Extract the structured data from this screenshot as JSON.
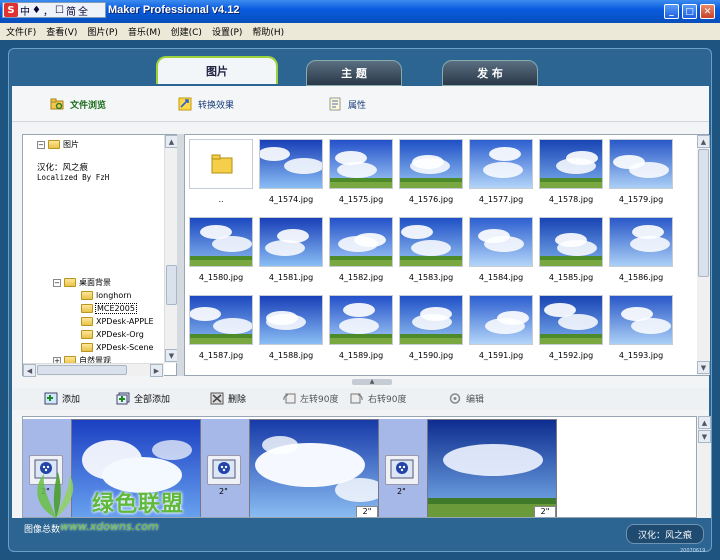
{
  "window": {
    "ime": [
      "中",
      "♦",
      "，",
      "☐",
      "简",
      "全"
    ],
    "title": "Maker Professional v4.12",
    "minimize": "_",
    "maximize": "□",
    "close": "✕"
  },
  "menu": [
    "文件(F)",
    "查看(V)",
    "图片(P)",
    "音乐(M)",
    "创建(C)",
    "设置(P)",
    "帮助(H)"
  ],
  "tabs": {
    "photos": "图片",
    "theme": "主 题",
    "publish": "发 布"
  },
  "subtabs": {
    "browse": "文件浏览",
    "transition": "转换效果",
    "properties": "属性"
  },
  "tree": {
    "root": "图片",
    "credit1": "汉化：风之痕",
    "credit2": "Localized By FzH",
    "desktop_bg": "桌面背景",
    "items": [
      "longhorn",
      "MCE2005",
      "XPDesk-APPLE",
      "XPDesk-Org",
      "XPDesk-Scene"
    ],
    "next": "自然景观"
  },
  "grid": {
    "up_label": "..",
    "files": [
      "4_1574.jpg",
      "4_1575.jpg",
      "4_1576.jpg",
      "4_1577.jpg",
      "4_1578.jpg",
      "4_1579.jpg",
      "4_1580.jpg",
      "4_1581.jpg",
      "4_1582.jpg",
      "4_1583.jpg",
      "4_1584.jpg",
      "4_1585.jpg",
      "4_1586.jpg",
      "4_1587.jpg",
      "4_1588.jpg",
      "4_1589.jpg",
      "4_1590.jpg",
      "4_1591.jpg",
      "4_1592.jpg",
      "4_1593.jpg"
    ]
  },
  "toolbar": {
    "add": "添加",
    "add_all": "全部添加",
    "delete": "删除",
    "rotate_left": "左转90度",
    "rotate_right": "右转90度",
    "edit": "编辑"
  },
  "timeline": {
    "transition_duration": "2\"",
    "slide_duration": "2\""
  },
  "watermark": {
    "brand": "绿色联盟",
    "url": "www.xdowns.com"
  },
  "status": {
    "left": "图像总数",
    "right": "汉化：风之痕",
    "tiny": "20070619"
  }
}
